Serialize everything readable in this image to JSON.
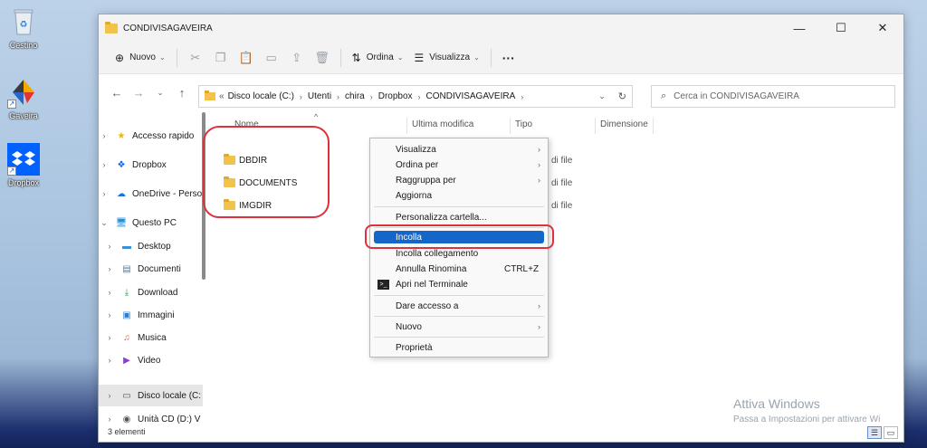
{
  "desktop": {
    "icons": [
      {
        "label": "Cestino",
        "icon": "recycle-bin-icon"
      },
      {
        "label": "Gaveira",
        "icon": "gaveira-app-icon"
      },
      {
        "label": "Dropbox",
        "icon": "dropbox-icon"
      }
    ]
  },
  "window": {
    "title": "CONDIVISAGAVEIRA",
    "controls": {
      "minimize": "—",
      "maximize": "☐",
      "close": "✕"
    }
  },
  "toolbar": {
    "new_label": "Nuovo",
    "sort_label": "Ordina",
    "view_label": "Visualizza",
    "more": "···"
  },
  "address": {
    "overflow": "«",
    "crumbs": [
      "Disco locale (C:)",
      "Utenti",
      "chira",
      "Dropbox",
      "CONDIVISAGAVEIRA"
    ],
    "search_placeholder": "Cerca in CONDIVISAGAVEIRA"
  },
  "sidebar": {
    "items": [
      {
        "label": "Accesso rapido",
        "icon": "star-icon"
      },
      {
        "label": "Dropbox",
        "icon": "dropbox-icon"
      },
      {
        "label": "OneDrive - Perso",
        "icon": "onedrive-icon"
      },
      {
        "label": "Questo PC",
        "icon": "computer-icon"
      },
      {
        "label": "Desktop",
        "icon": "desktop-icon"
      },
      {
        "label": "Documenti",
        "icon": "documents-icon"
      },
      {
        "label": "Download",
        "icon": "download-icon"
      },
      {
        "label": "Immagini",
        "icon": "pictures-icon"
      },
      {
        "label": "Musica",
        "icon": "music-icon"
      },
      {
        "label": "Video",
        "icon": "video-icon"
      },
      {
        "label": "Disco locale (C:",
        "icon": "drive-icon"
      },
      {
        "label": "Unità CD (D:) V",
        "icon": "cd-drive-icon"
      }
    ]
  },
  "columns": {
    "name": "Nome",
    "modified": "Ultima modifica",
    "type": "Tipo",
    "size": "Dimensione"
  },
  "files": [
    {
      "name": "DBDIR",
      "type": "di file"
    },
    {
      "name": "DOCUMENTS",
      "type": "di file"
    },
    {
      "name": "IMGDIR",
      "type": "di file"
    }
  ],
  "context_menu": {
    "items": {
      "visualizza": "Visualizza",
      "ordina": "Ordina per",
      "raggruppa": "Raggruppa per",
      "aggiorna": "Aggiorna",
      "personalizza": "Personalizza cartella...",
      "incolla": "Incolla",
      "incolla_collegamento": "Incolla collegamento",
      "annulla": "Annulla Rinomina",
      "annulla_shortcut": "CTRL+Z",
      "terminale": "Apri nel Terminale",
      "accesso": "Dare accesso a",
      "nuovo": "Nuovo",
      "proprieta": "Proprietà"
    }
  },
  "status": {
    "count": "3 elementi"
  },
  "watermark": {
    "title": "Attiva Windows",
    "subtitle": "Passa a Impostazioni per attivare Wi"
  },
  "colors": {
    "highlight": "#1566c9",
    "annotation_red": "#e0303e",
    "folder": "#f2c34a"
  }
}
